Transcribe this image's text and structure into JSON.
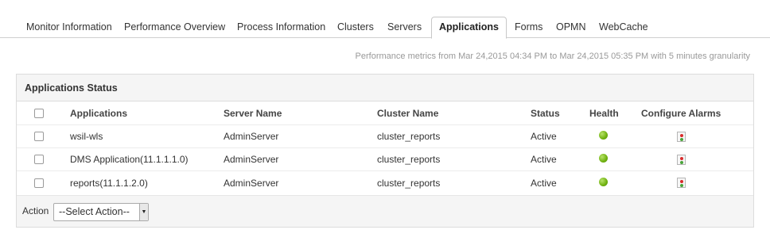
{
  "tabs": [
    {
      "label": "Monitor Information"
    },
    {
      "label": "Performance Overview"
    },
    {
      "label": "Process Information"
    },
    {
      "label": "Clusters"
    },
    {
      "label": "Servers"
    },
    {
      "label": "Applications",
      "active": true
    },
    {
      "label": "Forms"
    },
    {
      "label": "OPMN"
    },
    {
      "label": "WebCache"
    }
  ],
  "perf_note": "Performance metrics from Mar 24,2015 04:34 PM to Mar 24,2015 05:35 PM with 5 minutes granularity",
  "panel": {
    "title": "Applications Status",
    "columns": {
      "applications": "Applications",
      "server": "Server Name",
      "cluster": "Cluster Name",
      "status": "Status",
      "health": "Health",
      "alarms": "Configure Alarms"
    },
    "rows": [
      {
        "application": "wsil-wls",
        "server": "AdminServer",
        "cluster": "cluster_reports",
        "status": "Active",
        "health": "green-status-icon",
        "alarm_icon": "configure-alarm-icon"
      },
      {
        "application": "DMS Application(11.1.1.1.0)",
        "server": "AdminServer",
        "cluster": "cluster_reports",
        "status": "Active",
        "health": "green-status-icon",
        "alarm_icon": "configure-alarm-icon"
      },
      {
        "application": "reports(11.1.1.2.0)",
        "server": "AdminServer",
        "cluster": "cluster_reports",
        "status": "Active",
        "health": "green-status-icon",
        "alarm_icon": "configure-alarm-icon"
      }
    ],
    "action_label": "Action",
    "action_select_value": "--Select Action--"
  },
  "colors": {
    "health_green": "#6fb10f",
    "alarm_red": "#d92c2c",
    "header_bg": "#f5f5f5"
  }
}
